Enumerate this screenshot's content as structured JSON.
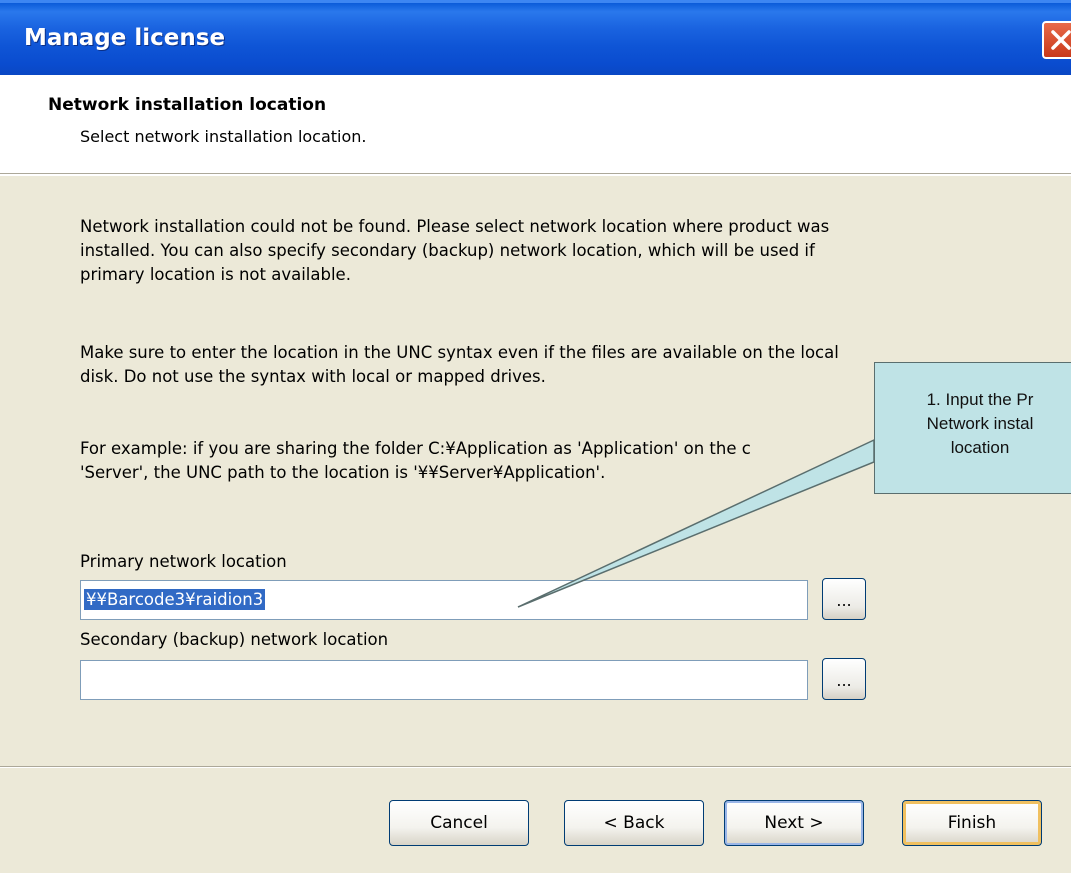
{
  "window": {
    "title": "Manage license"
  },
  "header": {
    "heading": "Network installation location",
    "subheading": "Select network installation location."
  },
  "body": {
    "paragraph1_line1": "Network installation could not be found. Please select network location where product was",
    "paragraph1_line2": "installed. You can also specify secondary (backup) network location, which will be used if",
    "paragraph1_line3": "primary location is not available.",
    "paragraph2_line1": "Make sure to enter the location in the UNC syntax even if the files are available on the local",
    "paragraph2_line2": "disk. Do not use the syntax with local or mapped drives.",
    "paragraph3_line1": "For example: if you are sharing the folder C:¥Application as 'Application' on the c",
    "paragraph3_line2": "'Server', the UNC path to the location is '¥¥Server¥Application'."
  },
  "fields": {
    "primary": {
      "label": "Primary network location",
      "value": "¥¥Barcode3¥raidion3",
      "browse_label": "..."
    },
    "secondary": {
      "label": "Secondary (backup) network location",
      "value": "",
      "browse_label": "..."
    }
  },
  "buttons": {
    "cancel": "Cancel",
    "back": "< Back",
    "next": "Next >",
    "finish": "Finish"
  },
  "callout": {
    "line1": "1. Input  the Pr",
    "line2": "Network instal",
    "line3": "location"
  },
  "icons": {
    "close": "close-icon"
  },
  "colors": {
    "titlebar": "#0a4ccf",
    "dialog_bg": "#ece9d8",
    "callout_bg": "#bfe3e6",
    "selection": "#316ac5"
  }
}
